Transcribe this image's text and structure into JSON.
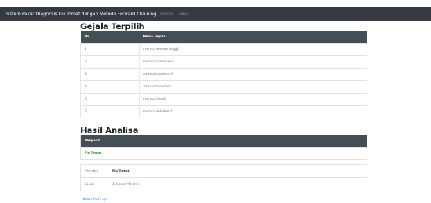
{
  "navbar": {
    "brand": "Sistem Pakar Diagnosis Flu Tomat dengan Metode Forward Chaining",
    "links": [
      "Beranda",
      "Logout"
    ]
  },
  "gejala": {
    "title": "Gejala Terpilih",
    "headers": [
      "No",
      "Nama Gejala"
    ],
    "rows": [
      {
        "no": "1",
        "name": "merasa demam tinggi?"
      },
      {
        "no": "2",
        "name": "merasa kelelahan?"
      },
      {
        "no": "3",
        "name": "ada kulit melepuh?"
      },
      {
        "no": "4",
        "name": "ada ruam merah?"
      },
      {
        "no": "5",
        "name": "merasa iritasi?"
      },
      {
        "no": "6",
        "name": "merasa dehidrasi?"
      }
    ]
  },
  "hasil": {
    "title": "Hasil Analisa",
    "header": "Penyakit",
    "value": "Flu Tomat",
    "detail": [
      {
        "label": "Penyakit",
        "value": "Flu Tomat"
      },
      {
        "label": "Solusi",
        "value": "1. Isolasi Mandiri"
      }
    ]
  },
  "footer": {
    "link": "Konsultasi Lagi"
  }
}
